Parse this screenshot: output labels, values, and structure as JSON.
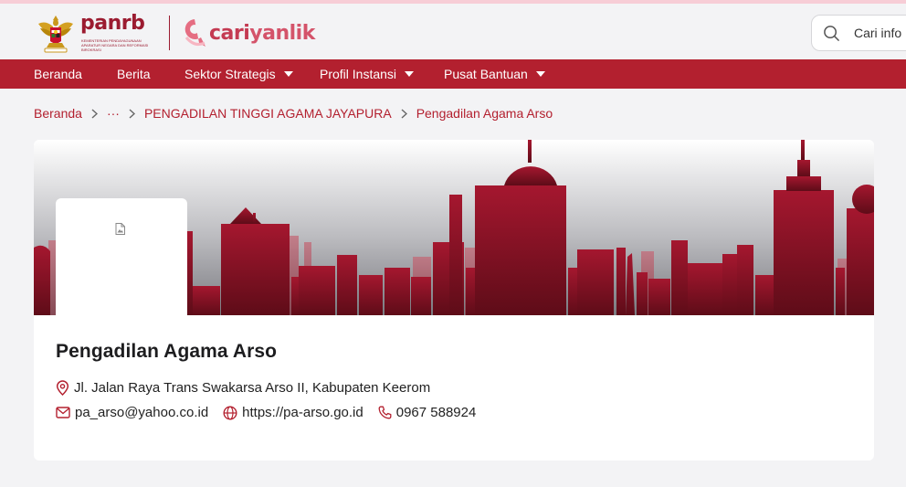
{
  "header": {
    "panrb_word": "panrb",
    "panrb_subtitle": "KEMENTERIAN PENDAYAGUNAAN APARATUR NEGARA DAN REFORMASI BIROKRASI",
    "cari_logo": {
      "part1": "cari",
      "part2": "yanlik"
    },
    "search": {
      "placeholder": "Cari info"
    }
  },
  "nav": {
    "items": [
      {
        "label": "Beranda",
        "has_dropdown": false
      },
      {
        "label": "Berita",
        "has_dropdown": false
      },
      {
        "label": "Sektor Strategis",
        "has_dropdown": true
      },
      {
        "label": "Profil Instansi",
        "has_dropdown": true
      },
      {
        "label": "Pusat Bantuan",
        "has_dropdown": true
      }
    ]
  },
  "breadcrumb": {
    "home": "Beranda",
    "ellipsis": "···",
    "parent": "PENGADILAN TINGGI AGAMA JAYAPURA",
    "current": "Pengadilan Agama Arso"
  },
  "institution": {
    "name": "Pengadilan Agama Arso",
    "address": "Jl. Jalan Raya Trans Swakarsa Arso II, Kabupaten Keerom",
    "email": "pa_arso@yahoo.co.id",
    "website": "https://pa-arso.go.id",
    "phone": "0967 588924"
  },
  "colors": {
    "brand": "#b3202f",
    "brand_dark": "#9b1b30",
    "skyline": "#8e1426",
    "page_bg": "#f3f3f5"
  },
  "icons": [
    "garuda-emblem",
    "cariyanlik-logo-icon",
    "search-icon",
    "chevron-down-icon",
    "chevron-right-icon",
    "broken-image-icon",
    "map-pin-icon",
    "mail-icon",
    "globe-icon",
    "phone-icon"
  ]
}
